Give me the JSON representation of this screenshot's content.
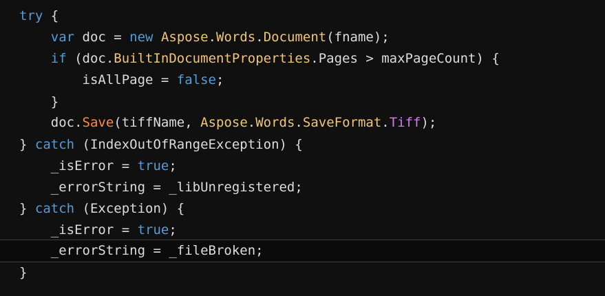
{
  "code": {
    "lines": [
      {
        "tokens": [
          {
            "t": "try",
            "c": "kw"
          },
          {
            "t": " {",
            "c": "punc"
          }
        ]
      },
      {
        "tokens": [
          {
            "t": "    ",
            "c": "punc"
          },
          {
            "t": "var",
            "c": "kw"
          },
          {
            "t": " doc = ",
            "c": "id"
          },
          {
            "t": "new",
            "c": "kw"
          },
          {
            "t": " ",
            "c": "id"
          },
          {
            "t": "Aspose",
            "c": "cls"
          },
          {
            "t": ".",
            "c": "punc"
          },
          {
            "t": "Words",
            "c": "cls"
          },
          {
            "t": ".",
            "c": "punc"
          },
          {
            "t": "Document",
            "c": "cls"
          },
          {
            "t": "(fname);",
            "c": "id"
          }
        ]
      },
      {
        "tokens": [
          {
            "t": "    ",
            "c": "punc"
          },
          {
            "t": "if",
            "c": "kw"
          },
          {
            "t": " (doc.",
            "c": "id"
          },
          {
            "t": "BuiltInDocumentProperties",
            "c": "cls"
          },
          {
            "t": ".Pages > maxPageCount) {",
            "c": "id"
          }
        ]
      },
      {
        "tokens": [
          {
            "t": "        isAllPage = ",
            "c": "id"
          },
          {
            "t": "false",
            "c": "kw"
          },
          {
            "t": ";",
            "c": "punc"
          }
        ]
      },
      {
        "tokens": [
          {
            "t": "    }",
            "c": "punc"
          }
        ]
      },
      {
        "tokens": [
          {
            "t": "    doc.",
            "c": "id"
          },
          {
            "t": "Save",
            "c": "mth"
          },
          {
            "t": "(tiffName, ",
            "c": "id"
          },
          {
            "t": "Aspose",
            "c": "cls"
          },
          {
            "t": ".",
            "c": "punc"
          },
          {
            "t": "Words",
            "c": "cls"
          },
          {
            "t": ".",
            "c": "punc"
          },
          {
            "t": "SaveFormat",
            "c": "cls"
          },
          {
            "t": ".",
            "c": "punc"
          },
          {
            "t": "Tiff",
            "c": "tiff"
          },
          {
            "t": ");",
            "c": "punc"
          }
        ]
      },
      {
        "tokens": [
          {
            "t": "} ",
            "c": "punc"
          },
          {
            "t": "catch",
            "c": "kw"
          },
          {
            "t": " (IndexOutOfRangeException) {",
            "c": "id"
          }
        ]
      },
      {
        "tokens": [
          {
            "t": "    _isError = ",
            "c": "id"
          },
          {
            "t": "true",
            "c": "kw"
          },
          {
            "t": ";",
            "c": "punc"
          }
        ]
      },
      {
        "tokens": [
          {
            "t": "    _errorString = _libUnregistered;",
            "c": "id"
          }
        ]
      },
      {
        "tokens": [
          {
            "t": "} ",
            "c": "punc"
          },
          {
            "t": "catch",
            "c": "kw"
          },
          {
            "t": " (Exception) {",
            "c": "id"
          }
        ]
      },
      {
        "tokens": [
          {
            "t": "    _isError = ",
            "c": "id"
          },
          {
            "t": "true",
            "c": "kw"
          },
          {
            "t": ";",
            "c": "punc"
          }
        ]
      },
      {
        "tokens": [
          {
            "t": "    _errorString = _fileBroken;",
            "c": "id"
          }
        ],
        "current": true
      },
      {
        "tokens": [
          {
            "t": "}",
            "c": "punc"
          }
        ]
      }
    ]
  },
  "colors": {
    "background": "#101010",
    "keyword": "#569cd6",
    "class_name": "#f0c674",
    "method": "#ff8c3a",
    "enum_member": "#d07cf0",
    "text": "#dcdcdc"
  }
}
